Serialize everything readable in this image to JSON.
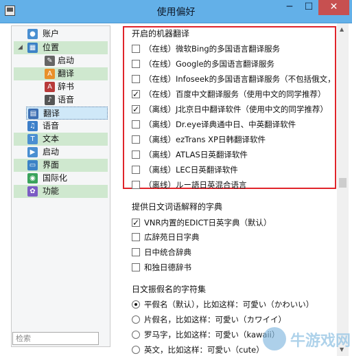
{
  "window": {
    "title": "使用偏好",
    "minimize": "─",
    "maximize": "☐",
    "close": "✕"
  },
  "sidebar": {
    "items": [
      {
        "label": "账户",
        "icon": "person-icon",
        "color": "#4a8fd1",
        "glyph": "●"
      },
      {
        "label": "位置",
        "icon": "building-icon",
        "color": "#3b82c6",
        "glyph": "▦",
        "arrow": "◢"
      },
      {
        "label": "启动",
        "icon": "pin-icon",
        "color": "#666666",
        "glyph": "✎"
      },
      {
        "label": "翻译",
        "icon": "translate-icon",
        "color": "#e9902a",
        "glyph": "A"
      },
      {
        "label": "辞书",
        "icon": "book-icon",
        "color": "#b83a3a",
        "glyph": "A"
      },
      {
        "label": "语音",
        "icon": "speaker-icon",
        "color": "#555555",
        "glyph": "♪"
      },
      {
        "label": "翻译",
        "icon": "translate-icon",
        "color": "#3d6fb3",
        "glyph": "▤"
      },
      {
        "label": "语音",
        "icon": "music-icon",
        "color": "#3d7fc9",
        "glyph": "♫"
      },
      {
        "label": "文本",
        "icon": "text-icon",
        "color": "#4a8fd1",
        "glyph": "T"
      },
      {
        "label": "启动",
        "icon": "launch-icon",
        "color": "#4a8fd1",
        "glyph": "▶"
      },
      {
        "label": "界面",
        "icon": "window-icon",
        "color": "#3b82c6",
        "glyph": "▭"
      },
      {
        "label": "国际化",
        "icon": "globe-icon",
        "color": "#3aa35b",
        "glyph": "◉"
      },
      {
        "label": "功能",
        "icon": "puzzle-icon",
        "color": "#7b5cc4",
        "glyph": "✿"
      }
    ],
    "search_placeholder": "检索"
  },
  "translators": {
    "title": "开启的机器翻译",
    "options": [
      {
        "label": "（在线）微软Bing的多国语言翻译服务",
        "checked": false
      },
      {
        "label": "（在线）Google的多国语言翻译服务",
        "checked": false
      },
      {
        "label": "（在线）Infoseek的多国语言翻译服务（不包括俄文，",
        "checked": false
      },
      {
        "label": "（在线）百度中文翻译服务（使用中文的同学推荐）",
        "checked": true
      },
      {
        "label": "（离线）J北京日中翻译软件（使用中文的同学推荐）",
        "checked": true
      },
      {
        "label": "（离线）Dr.eye译典通中日、中英翻译软件",
        "checked": false
      },
      {
        "label": "（离线）ezTrans XP日韩翻译软件",
        "checked": false
      },
      {
        "label": "（离线）ATLAS日英翻译软件",
        "checked": false
      },
      {
        "label": "（离线）LEC日英翻译软件",
        "checked": false
      },
      {
        "label": "（离线）ルー語日英混合语言",
        "checked": false
      }
    ]
  },
  "dictionaries": {
    "title": "提供日文词语解释的字典",
    "options": [
      {
        "label": "VNR内置的EDICT日英字典（默认）",
        "checked": true
      },
      {
        "label": "広辞苑日日字典",
        "checked": false
      },
      {
        "label": "日中统合辞典",
        "checked": false
      },
      {
        "label": "和独日德辞书",
        "checked": false
      }
    ]
  },
  "kana": {
    "title": "日文振假名的字符集",
    "options": [
      {
        "label": "平假名（默认），比如这样：可愛い（かわいい）",
        "checked": true
      },
      {
        "label": "片假名，比如这样：可愛い（カワイイ）",
        "checked": false
      },
      {
        "label": "罗马字，比如这样：可愛い（kawaii）",
        "checked": false
      },
      {
        "label": "英文，比如这样：可愛い（cute）",
        "checked": false
      }
    ]
  },
  "scrollbar": {
    "up": "▲",
    "down": "▼"
  },
  "watermark": {
    "text": "牛游戏网"
  }
}
